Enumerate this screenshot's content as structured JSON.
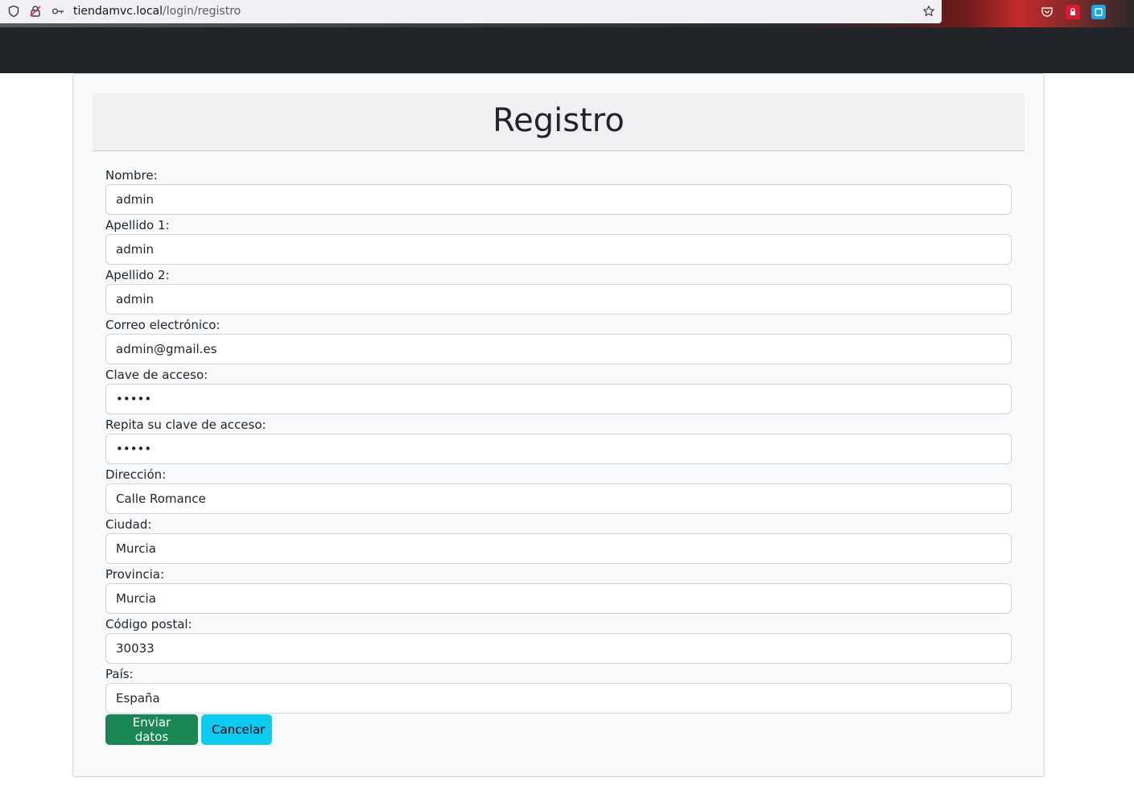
{
  "browser": {
    "url_host": "tiendamvc.local",
    "url_path": "/login/registro",
    "icons": [
      "shield-icon",
      "lock-slash-icon",
      "key-icon",
      "star-icon",
      "pocket-icon",
      "adblock-icon",
      "extension-icon"
    ]
  },
  "card": {
    "title": "Registro"
  },
  "form": {
    "fields": [
      {
        "label": "Nombre:",
        "value": "admin",
        "type": "text"
      },
      {
        "label": "Apellido 1:",
        "value": "admin",
        "type": "text"
      },
      {
        "label": "Apellido 2:",
        "value": "admin",
        "type": "text"
      },
      {
        "label": "Correo electrónico:",
        "value": "admin@gmail.es",
        "type": "email"
      },
      {
        "label": "Clave de acceso:",
        "value": "admin",
        "type": "password"
      },
      {
        "label": "Repita su clave de acceso:",
        "value": "admin",
        "type": "password"
      },
      {
        "label": "Dirección:",
        "value": "Calle Romance",
        "type": "text"
      },
      {
        "label": "Ciudad:",
        "value": "Murcia",
        "type": "text"
      },
      {
        "label": "Provincia:",
        "value": "Murcia",
        "type": "text"
      },
      {
        "label": "Código postal:",
        "value": "30033",
        "type": "text"
      },
      {
        "label": "País:",
        "value": "España",
        "type": "text"
      }
    ],
    "submit_label": "Enviar datos",
    "cancel_label": "Cancelar"
  },
  "colors": {
    "navbar": "#212529",
    "success": "#198754",
    "info": "#0dcaf0"
  }
}
